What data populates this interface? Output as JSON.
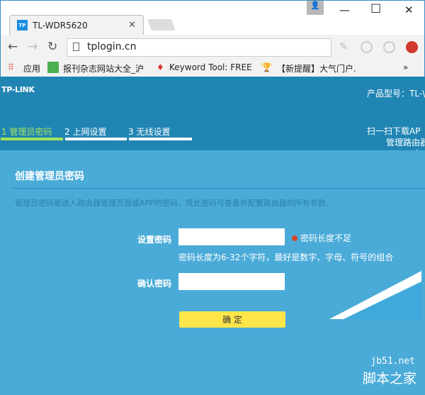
{
  "browser": {
    "tab_title": "TL-WDR5620",
    "favicon": "TP",
    "url": "tplogin.cn",
    "bookmarks": [
      "应用",
      "报刊杂志网站大全_沪",
      "Keyword Tool: FREE",
      "【新提醒】大气门户."
    ],
    "more": "»"
  },
  "header": {
    "logo": "TP-LINK",
    "model_label": "产品型号：TL-\\",
    "steps": [
      "1 管理员密码",
      "2 上网设置",
      "3 无线设置"
    ],
    "scan_lines": [
      "扫一扫下载AP",
      "管理路由器",
      "产"
    ]
  },
  "colors": {
    "header": "#2185b4",
    "panel": "#4aabd8",
    "active_step": "#a3e45a",
    "button": "#fde54a"
  },
  "form": {
    "title": "创建管理员密码",
    "description": "管理员密码是进入路由器管理页面或APP的密码，凭此密码可查看并配置路由器的所有参数。",
    "password_label": "设置密码",
    "password_value": "",
    "error": "密码长度不足",
    "hint": "密码长度为6-32个字符，最好是数字、字母、符号的组合",
    "confirm_label": "确认密码",
    "confirm_value": "",
    "submit": "确 定"
  },
  "watermark": {
    "site": "jb51.net",
    "name": "脚本之家"
  }
}
